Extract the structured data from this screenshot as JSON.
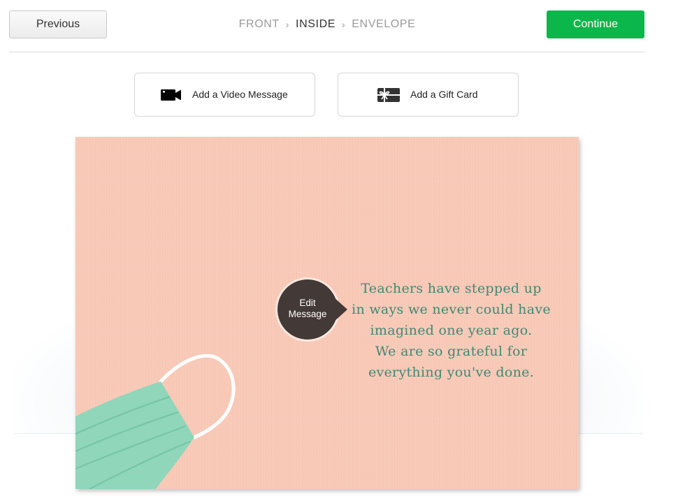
{
  "nav": {
    "previous_label": "Previous",
    "continue_label": "Continue",
    "steps": [
      {
        "label": "FRONT",
        "active": false
      },
      {
        "label": "INSIDE",
        "active": true
      },
      {
        "label": "ENVELOPE",
        "active": false
      }
    ],
    "separator_icon": "chevron-right-icon"
  },
  "addons": {
    "video": {
      "label": "Add a Video Message",
      "icon": "video-camera-icon"
    },
    "gift": {
      "label": "Add a Gift Card",
      "icon": "gift-card-icon"
    }
  },
  "card": {
    "background_color": "#f9c9b7",
    "text_color": "#3d8a74",
    "edit_label_line1": "Edit",
    "edit_label_line2": "Message",
    "message_lines": [
      "Teachers have stepped up",
      "in ways we never could have",
      "imagined one year ago.",
      "We are so grateful for",
      "everything you've done."
    ]
  },
  "colors": {
    "continue_green": "#0bb64a",
    "edit_bubble": "#433936",
    "mask_green": "#8fd6ba"
  }
}
